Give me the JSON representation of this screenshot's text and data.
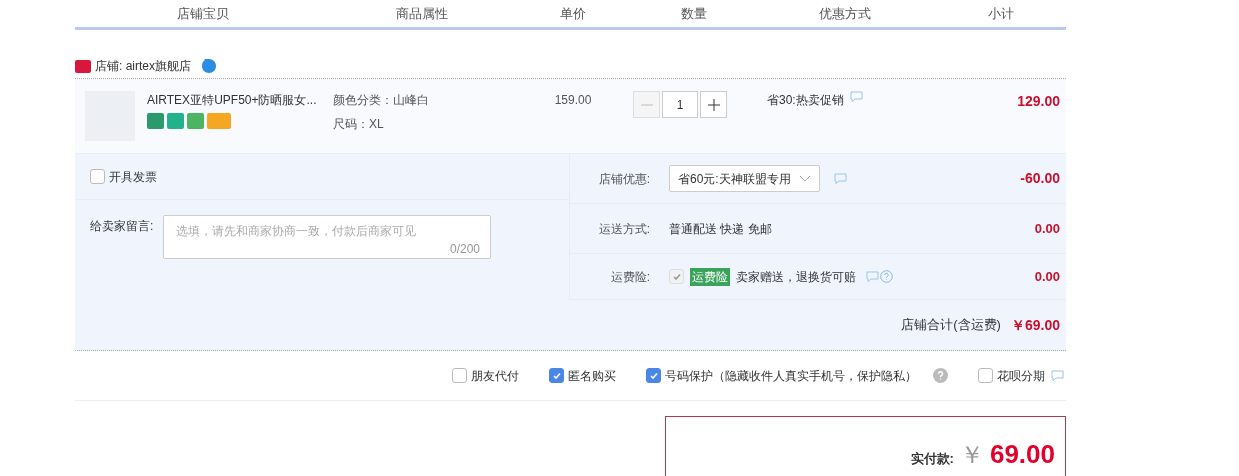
{
  "columns": [
    "店铺宝贝",
    "商品属性",
    "单价",
    "数量",
    "优惠方式",
    "小计"
  ],
  "shop": {
    "label": "店铺: airtex旗舰店"
  },
  "item": {
    "name": "AIRTEX亚特UPF50+防晒服女...",
    "attrs": [
      "颜色分类：山峰白",
      "尺码：XL"
    ],
    "price": "159.00",
    "quantity": "1",
    "promo": "省30:热卖促销",
    "subtotal": "129.00"
  },
  "invoice": {
    "label": "开具发票",
    "checked": false
  },
  "message": {
    "label": "给卖家留言:",
    "placeholder": "选填，请先和商家协商一致，付款后商家可见",
    "counter": "0/200"
  },
  "discount": {
    "label": "店铺优惠:",
    "value": "省60元:天神联盟专用",
    "amount": "-60.00"
  },
  "shipping": {
    "label": "运送方式:",
    "value": "普通配送 快递 免邮",
    "amount": "0.00"
  },
  "insurance": {
    "label": "运费险:",
    "checked": true,
    "disabled": true,
    "tag": "运费险",
    "text": "卖家赠送，退换货可赔",
    "amount": "0.00"
  },
  "shop_total": {
    "label": "店铺合计(含运费)",
    "amount": "￥69.00"
  },
  "options": [
    {
      "label": "朋友代付",
      "checked": false,
      "kind": "plain"
    },
    {
      "label": "匿名购买",
      "checked": true,
      "kind": "plain"
    },
    {
      "label": "号码保护（隐藏收件人真实手机号，保护隐私）",
      "checked": true,
      "kind": "help"
    },
    {
      "label": "花呗分期",
      "checked": false,
      "kind": "comment"
    }
  ],
  "payment": {
    "label": "实付款:",
    "currency": "￥",
    "amount": "69.00"
  }
}
